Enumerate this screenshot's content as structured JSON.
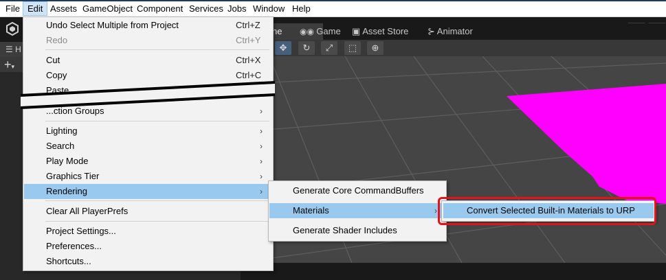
{
  "menubar": {
    "items": [
      "File",
      "Edit",
      "Assets",
      "GameObject",
      "Component",
      "Services",
      "Jobs",
      "Window",
      "Help"
    ],
    "active": "Edit"
  },
  "left_panel": {
    "tab_label": "H",
    "add_icon": "plus-icon"
  },
  "scene": {
    "tabs": [
      {
        "label": "ne",
        "icon": "scene-icon"
      },
      {
        "label": "Game",
        "icon": "gamepad-icon"
      },
      {
        "label": "Asset Store",
        "icon": "shopping-bag-icon"
      },
      {
        "label": "Animator",
        "icon": "animator-icon"
      }
    ],
    "tools": [
      "move-tool",
      "rotate-tool",
      "scale-tool",
      "rect-tool",
      "transform-tool"
    ]
  },
  "edit_menu": {
    "items": [
      {
        "label": "Undo Select Multiple from Project",
        "shortcut": "Ctrl+Z"
      },
      {
        "label": "Redo",
        "shortcut": "Ctrl+Y",
        "disabled": true
      },
      {
        "label": "Cut",
        "shortcut": "Ctrl+X"
      },
      {
        "label": "Copy",
        "shortcut": "Ctrl+C"
      },
      {
        "label": "Paste",
        "shortcut": ""
      },
      {
        "label": "...ction Groups",
        "submenu": true
      },
      {
        "label": "Lighting",
        "submenu": true
      },
      {
        "label": "Search",
        "submenu": true
      },
      {
        "label": "Play Mode",
        "submenu": true
      },
      {
        "label": "Graphics Tier",
        "submenu": true
      },
      {
        "label": "Rendering",
        "submenu": true,
        "highlighted": true
      },
      {
        "label": "Clear All PlayerPrefs"
      },
      {
        "label": "Project Settings..."
      },
      {
        "label": "Preferences..."
      },
      {
        "label": "Shortcuts..."
      }
    ]
  },
  "rendering_menu": {
    "items": [
      {
        "label": "Generate Core CommandBuffers"
      },
      {
        "label": "Materials",
        "submenu": true,
        "highlighted": true
      },
      {
        "label": "Generate Shader Includes"
      }
    ]
  },
  "materials_menu": {
    "items": [
      {
        "label": "Convert Selected Built-in Materials to URP",
        "highlighted": true
      }
    ]
  },
  "colors": {
    "highlight": "#99c9ef",
    "menu_bg": "#f2f2f2",
    "editor_dark": "#191919",
    "viewport_ground": "#444444",
    "magenta_object": "#ff00ff",
    "annotation_red": "#e3131b"
  }
}
